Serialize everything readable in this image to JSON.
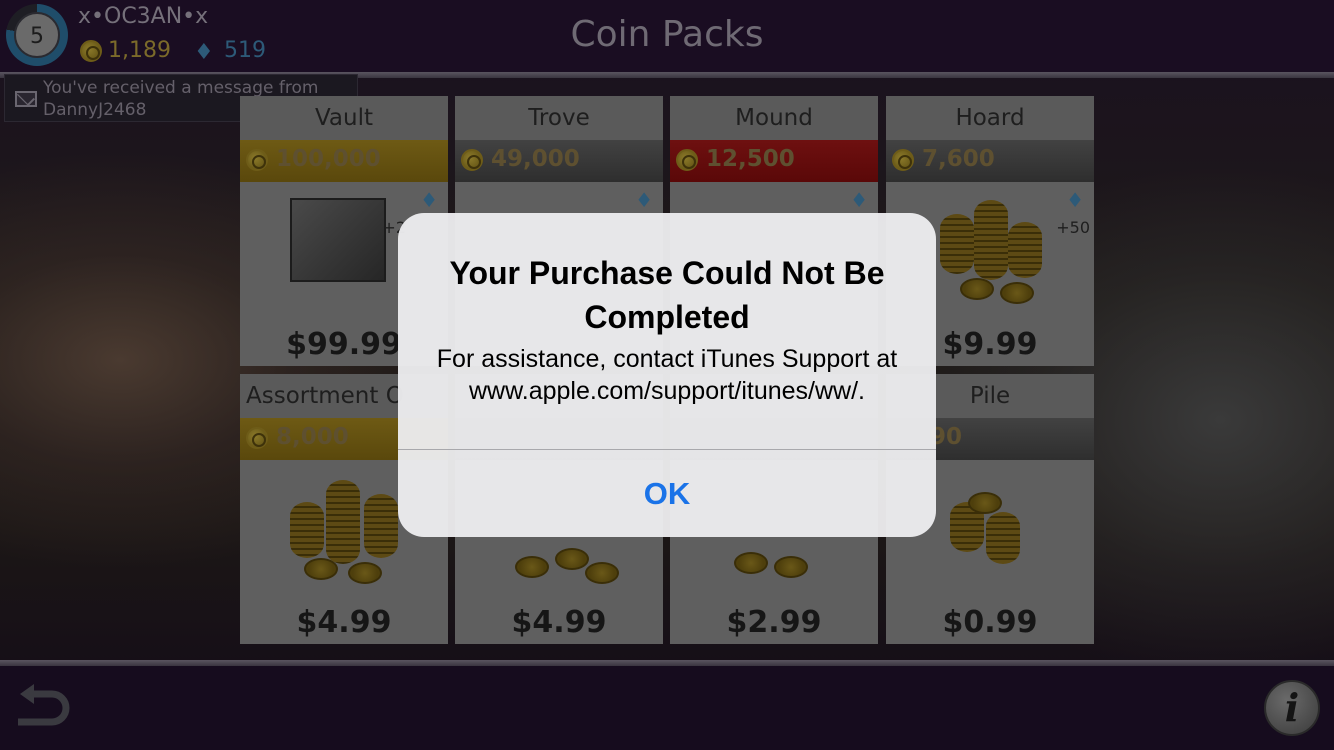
{
  "header": {
    "title": "Coin Packs",
    "username": "x•OC3AN•x",
    "level": "5",
    "coins": "1,189",
    "gems": "519"
  },
  "notification": {
    "text": "You've received a message from DannyJ2468"
  },
  "packs": [
    {
      "name": "Vault",
      "coins": "100,000",
      "price": "$99.99",
      "bonus": "+2"
    },
    {
      "name": "Trove",
      "coins": "49,000",
      "price": ""
    },
    {
      "name": "Mound",
      "coins": "12,500",
      "price": ""
    },
    {
      "name": "Hoard",
      "coins": "7,600",
      "price": "$9.99",
      "bonus": "+50"
    },
    {
      "name": "Assortment O",
      "coins": "8,000",
      "price": "$4.99"
    },
    {
      "name": "",
      "coins": "",
      "price": "$4.99"
    },
    {
      "name": "",
      "coins": "",
      "price": "$2.99"
    },
    {
      "name": "Pile",
      "coins": "90",
      "price": "$0.99"
    }
  ],
  "alert": {
    "title": "Your Purchase Could Not Be Completed",
    "message": "For assistance, contact iTunes Support at www.apple.com/support/itunes/ww/.",
    "ok_label": "OK"
  },
  "colors": {
    "ok_blue": "#1a73e8",
    "alert_bg": "#ececee",
    "gold_bar": "#6e5a14",
    "red_bar": "#6e1010"
  },
  "icons": {
    "back": "back-arrow-icon",
    "info": "info-icon",
    "coin": "coin-icon",
    "gem": "gem-icon",
    "envelope": "envelope-icon"
  }
}
